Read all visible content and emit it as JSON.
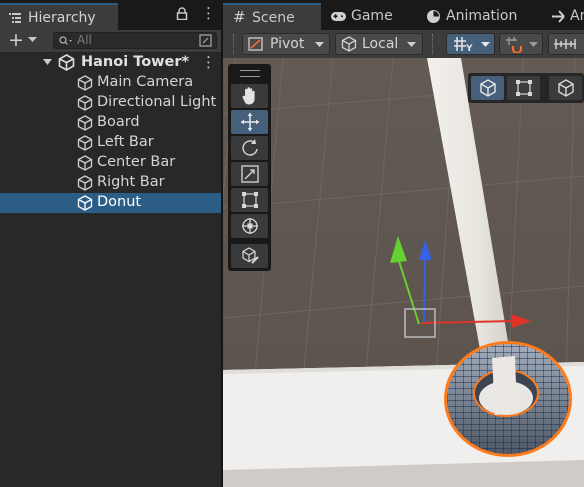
{
  "hierarchy": {
    "tab_label": "Hierarchy",
    "search_placeholder": "All",
    "scene_name": "Hanoi Tower*",
    "items": [
      {
        "label": "Main Camera"
      },
      {
        "label": "Directional Light"
      },
      {
        "label": "Board"
      },
      {
        "label": "Left Bar"
      },
      {
        "label": "Center Bar"
      },
      {
        "label": "Right Bar"
      },
      {
        "label": "Donut",
        "selected": true
      }
    ]
  },
  "scene_tabs": [
    {
      "label": "Scene",
      "active": true,
      "icon": "grid-icon"
    },
    {
      "label": "Game",
      "active": false,
      "icon": "gamepad-icon"
    },
    {
      "label": "Animation",
      "active": false,
      "icon": "animation-icon"
    },
    {
      "label": "An",
      "active": false,
      "icon": "animator-icon"
    }
  ],
  "scene_toolbar": {
    "pivot_label": "Pivot",
    "space_label": "Local"
  },
  "tools": [
    "hand-tool",
    "move-tool",
    "rotate-tool",
    "scale-tool",
    "rect-tool",
    "transform-tool",
    "custom-tool"
  ],
  "active_tool": "move-tool",
  "colors": {
    "selection": "#2c5d87",
    "x_axis": "#e0342a",
    "y_axis": "#63d130",
    "z_axis": "#3560e8",
    "outline": "#ff7a1a"
  }
}
